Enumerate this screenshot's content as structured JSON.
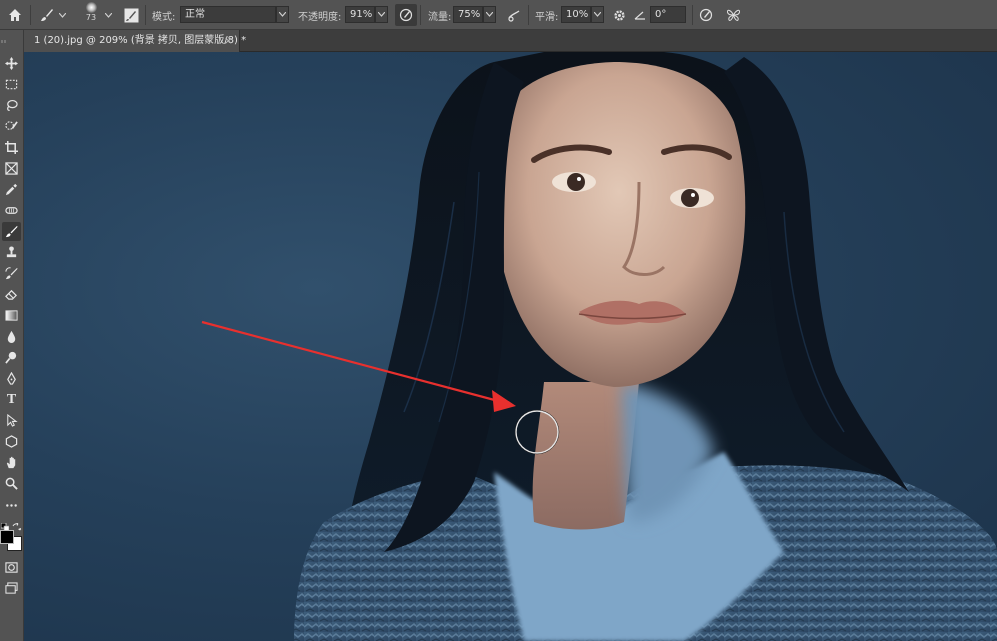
{
  "options_bar": {
    "brush_size": "73",
    "mode_label": "模式:",
    "mode_value": "正常",
    "opacity_label": "不透明度:",
    "opacity_value": "91%",
    "flow_label": "流量:",
    "flow_value": "75%",
    "smoothing_label": "平滑:",
    "smoothing_value": "10%",
    "angle_value": "0°"
  },
  "document_tab": {
    "title": "1 (20).jpg @ 209% (背景 拷贝, 图层蒙版/8) *",
    "close": "×"
  },
  "toolbar": {
    "active_tool": "brush-tool",
    "foreground_color": "#000000",
    "background_color": "#ffffff",
    "type_tool_label": "T"
  },
  "colors": {
    "ui_panel": "#535353",
    "annotation_arrow": "#e8302e",
    "backdrop": "#25405a"
  }
}
